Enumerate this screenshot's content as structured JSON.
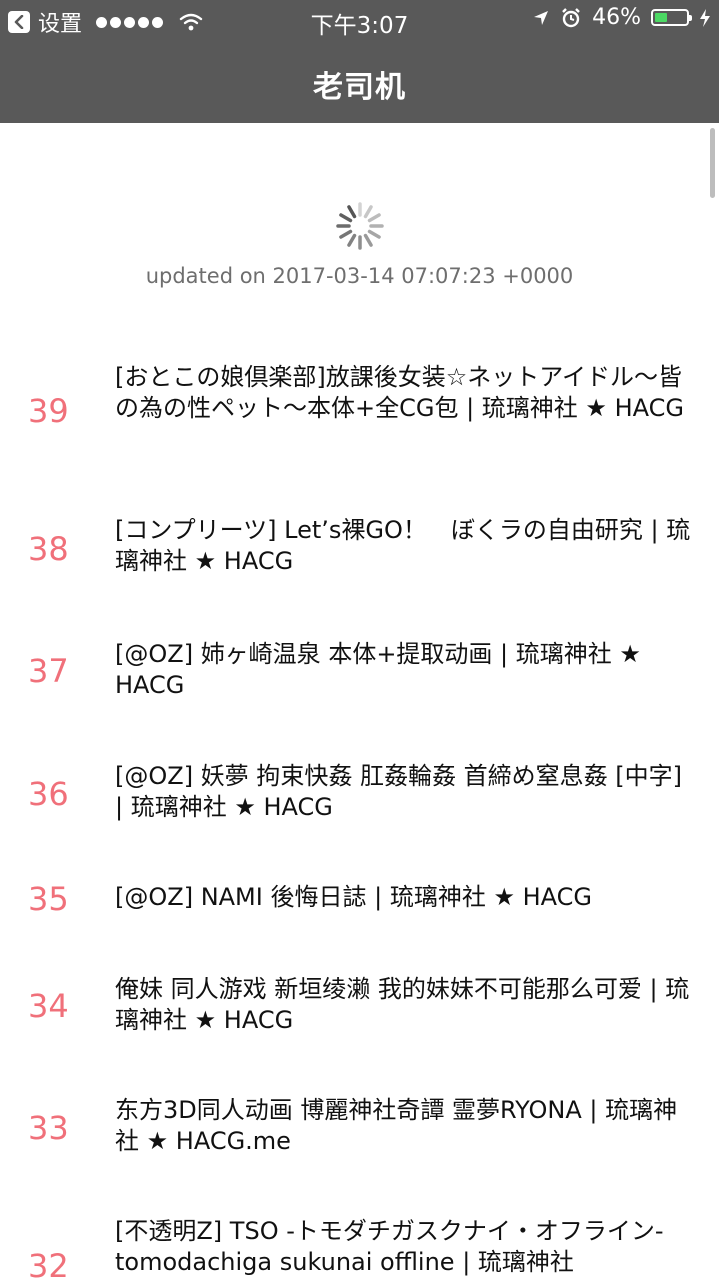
{
  "status_bar": {
    "back_app": "设置",
    "time": "下午3:07",
    "battery_percent": "46%",
    "battery_level": 0.46,
    "battery_color": "#4cd964"
  },
  "nav": {
    "title": "老司机"
  },
  "updated_text": "updated on 2017-03-14 07:07:23 +0000",
  "accent_color": "#f0707a",
  "items": [
    {
      "rank": "39",
      "title": "[おとこの娘倶楽部]放課後女装☆ネットアイドル～皆の為の性ペット～本体+全CG包 | 琉璃神社 ★ HACG"
    },
    {
      "rank": "38",
      "title": "[コンプリーツ] Let’s裸GO！　ぼくラの自由研究 | 琉璃神社 ★ HACG"
    },
    {
      "rank": "37",
      "title": "[@OZ] 姉ヶ崎温泉 本体+提取动画 | 琉璃神社 ★ HACG"
    },
    {
      "rank": "36",
      "title": "[@OZ] 妖夢 拘束快姦 肛姦輪姦 首締め窒息姦 [中字] | 琉璃神社 ★ HACG"
    },
    {
      "rank": "35",
      "title": "[@OZ] NAMI 後悔日誌 | 琉璃神社 ★ HACG"
    },
    {
      "rank": "34",
      "title": "俺妹 同人游戏 新垣绫濑 我的妹妹不可能那么可爱 | 琉璃神社 ★ HACG"
    },
    {
      "rank": "33",
      "title": "东方3D同人动画 博麗神社奇譚 霊夢RYONA | 琉璃神社 ★ HACG.me"
    },
    {
      "rank": "32",
      "title": "[不透明Z] TSO -トモダチガスクナイ・オフライン- tomodachiga sukunai offline | 琉璃神社"
    }
  ]
}
